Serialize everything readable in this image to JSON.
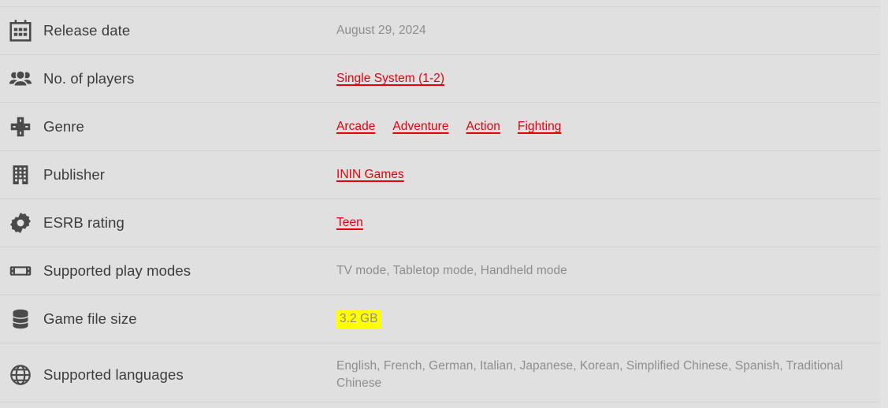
{
  "theme": {
    "background": "#e0e0e0",
    "divider": "#d1d1d1",
    "label_color": "#3c3c3c",
    "value_color": "#8e8e8e",
    "link_color": "#e4000f",
    "highlight_color": "#ffff00"
  },
  "rows": [
    {
      "icon": "calendar-icon",
      "label": "Release date",
      "value": "August 29, 2024",
      "type": "text"
    },
    {
      "icon": "players-group-icon",
      "label": "No. of players",
      "links": [
        "Single System (1-2)"
      ],
      "type": "links"
    },
    {
      "icon": "dpad-icon",
      "label": "Genre",
      "links": [
        "Arcade",
        "Adventure",
        "Action",
        "Fighting"
      ],
      "type": "links"
    },
    {
      "icon": "building-icon",
      "label": "Publisher",
      "links": [
        "ININ Games"
      ],
      "type": "links"
    },
    {
      "icon": "gear-icon",
      "label": "ESRB rating",
      "links": [
        "Teen"
      ],
      "type": "links"
    },
    {
      "icon": "switch-console-icon",
      "label": "Supported play modes",
      "value": "TV mode, Tabletop mode, Handheld mode",
      "type": "text"
    },
    {
      "icon": "database-icon",
      "label": "Game file size",
      "value": "3.2 GB",
      "type": "highlight"
    },
    {
      "icon": "globe-icon",
      "label": "Supported languages",
      "value": "English, French, German, Italian, Japanese, Korean, Simplified Chinese, Spanish, Traditional Chinese",
      "type": "text"
    }
  ]
}
